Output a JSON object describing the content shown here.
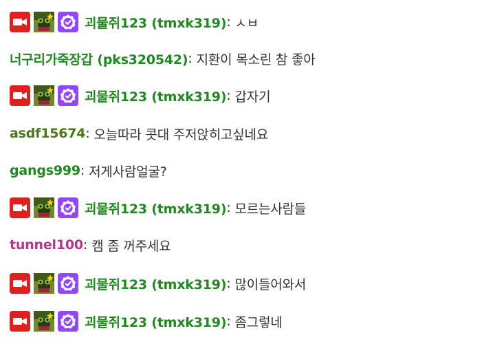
{
  "colors": {
    "background": "#ffffff",
    "text": "#333333",
    "name_green": "#1e8a1e",
    "name_olive": "#4a7a17",
    "name_pink": "#b5378a",
    "cam_badge_red": "#e01f1f",
    "verified_badge_purple": "#9147ff"
  },
  "badges": {
    "camera": "camera-badge-icon",
    "avatar": "frog-avatar-badge-icon",
    "verified": "verified-badge-icon"
  },
  "messages": [
    {
      "author": "괴물쥐123 (tmxk319)",
      "sep": ":",
      "text": "ㅅㅂ",
      "badges": true,
      "color": "#1e8a1e"
    },
    {
      "author": "너구리가죽장갑 (pks320542)",
      "sep": ":",
      "text": "지환이 목소린 참 좋아",
      "badges": false,
      "color": "#1e8a1e"
    },
    {
      "author": "괴물쥐123 (tmxk319)",
      "sep": ":",
      "text": "갑자기",
      "badges": true,
      "color": "#1e8a1e"
    },
    {
      "author": "asdf15674",
      "sep": ":",
      "text": "오늘따라 콧대 주저앉히고싶네요",
      "badges": false,
      "color": "#4a7a17"
    },
    {
      "author": "gangs999",
      "sep": ":",
      "text": "저게사람얼굴?",
      "badges": false,
      "color": "#1e8a1e"
    },
    {
      "author": "괴물쥐123 (tmxk319)",
      "sep": ":",
      "text": "모르는사람들",
      "badges": true,
      "color": "#1e8a1e"
    },
    {
      "author": "tunnel100",
      "sep": ":",
      "text": "캠 좀 꺼주세요",
      "badges": false,
      "color": "#b5378a"
    },
    {
      "author": "괴물쥐123 (tmxk319)",
      "sep": ":",
      "text": "많이들어와서",
      "badges": true,
      "color": "#1e8a1e"
    },
    {
      "author": "괴물쥐123 (tmxk319)",
      "sep": ":",
      "text": "좀그렇네",
      "badges": true,
      "color": "#1e8a1e"
    }
  ]
}
